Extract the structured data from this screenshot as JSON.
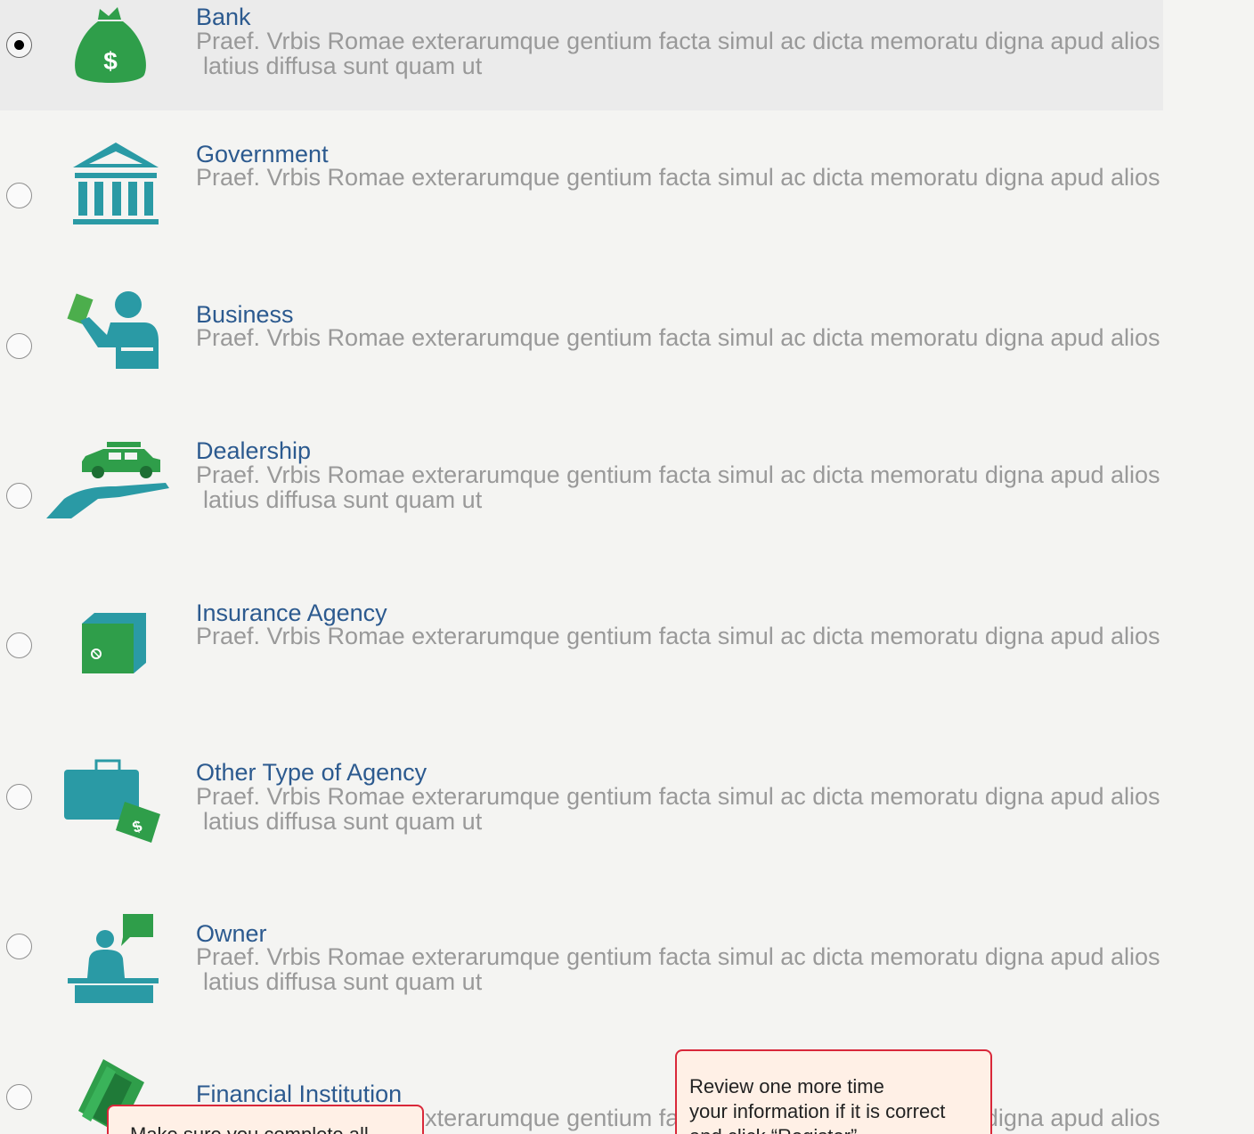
{
  "options": [
    {
      "title": "Bank",
      "desc1": "Praef. Vrbis Romae exterarumque gentium facta simul ac dicta memoratu digna apud alios",
      "desc2": "latius diffusa sunt quam ut",
      "selected": true
    },
    {
      "title": "Government",
      "desc1": "Praef. Vrbis Romae exterarumque gentium facta simul ac dicta memoratu digna apud alios",
      "desc2": "",
      "selected": false
    },
    {
      "title": "Business",
      "desc1": "Praef. Vrbis Romae exterarumque gentium facta simul ac dicta memoratu digna apud alios",
      "desc2": "",
      "selected": false
    },
    {
      "title": "Dealership",
      "desc1": "Praef. Vrbis Romae exterarumque gentium facta simul ac dicta memoratu digna apud alios",
      "desc2": "latius diffusa sunt quam ut",
      "selected": false
    },
    {
      "title": "Insurance Agency",
      "desc1": "Praef. Vrbis Romae exterarumque gentium facta simul ac dicta memoratu digna apud alios",
      "desc2": "",
      "selected": false
    },
    {
      "title": "Other Type of Agency",
      "desc1": "Praef. Vrbis Romae exterarumque gentium facta simul ac dicta memoratu digna apud alios",
      "desc2": "latius diffusa sunt quam ut",
      "selected": false
    },
    {
      "title": "Owner",
      "desc1": "Praef. Vrbis Romae exterarumque gentium facta simul ac dicta memoratu digna apud alios",
      "desc2": "latius diffusa sunt quam ut",
      "selected": false
    },
    {
      "title": "Financial Institution",
      "desc1": "Praef. Vrbis Romae exterarumque gentium facta simul ac dicta memoratu digna apud alios",
      "desc2": "",
      "selected": false
    }
  ],
  "callouts": {
    "review_line1": "Review one more time",
    "review_line2": "your information if it is correct",
    "review_line3": "and click “Register”",
    "bottom_left": "Make sure you complete all"
  },
  "icons": {
    "bank": "money-bag-icon",
    "government": "bank-building-icon",
    "business": "businessman-icon",
    "dealership": "car-in-hand-icon",
    "insurance": "safe-icon",
    "agency": "briefcase-money-icon",
    "owner": "person-desk-icon",
    "financial": "cash-stack-icon"
  },
  "colors": {
    "green": "#2f9e4a",
    "teal": "#2a9aa5",
    "title_blue": "#2c5a8f",
    "callout_border": "#d9283a",
    "callout_bg": "#fff0e6"
  }
}
